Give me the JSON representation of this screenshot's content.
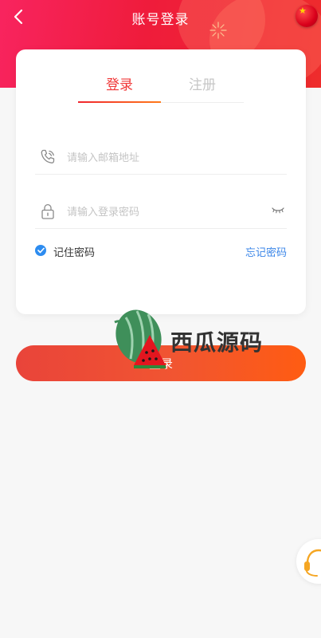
{
  "header": {
    "title": "账号登录",
    "back_icon": "chevron-left-icon",
    "language_icon": "china-flag-icon"
  },
  "tabs": [
    {
      "label": "登录",
      "active": true
    },
    {
      "label": "注册",
      "active": false
    }
  ],
  "form": {
    "email": {
      "placeholder": "请输入邮箱地址",
      "value": "",
      "icon": "phone-icon"
    },
    "password": {
      "placeholder": "请输入登录密码",
      "value": "",
      "icon": "lock-icon",
      "toggle_icon": "eye-closed-icon"
    },
    "remember_label": "记住密码",
    "remember_checked": true,
    "forgot_label": "忘记密码"
  },
  "login_button": "登录",
  "watermark": {
    "text": "西瓜源码",
    "icon": "watermelon-logo-icon"
  },
  "floating": {
    "icon": "headset-icon"
  },
  "colors": {
    "header_start": "#f8245f",
    "header_end": "#ee2c2c",
    "accent_red": "#f03838",
    "link_blue": "#3b86e8",
    "button_start": "#e9443a",
    "button_end": "#ff5c12"
  }
}
